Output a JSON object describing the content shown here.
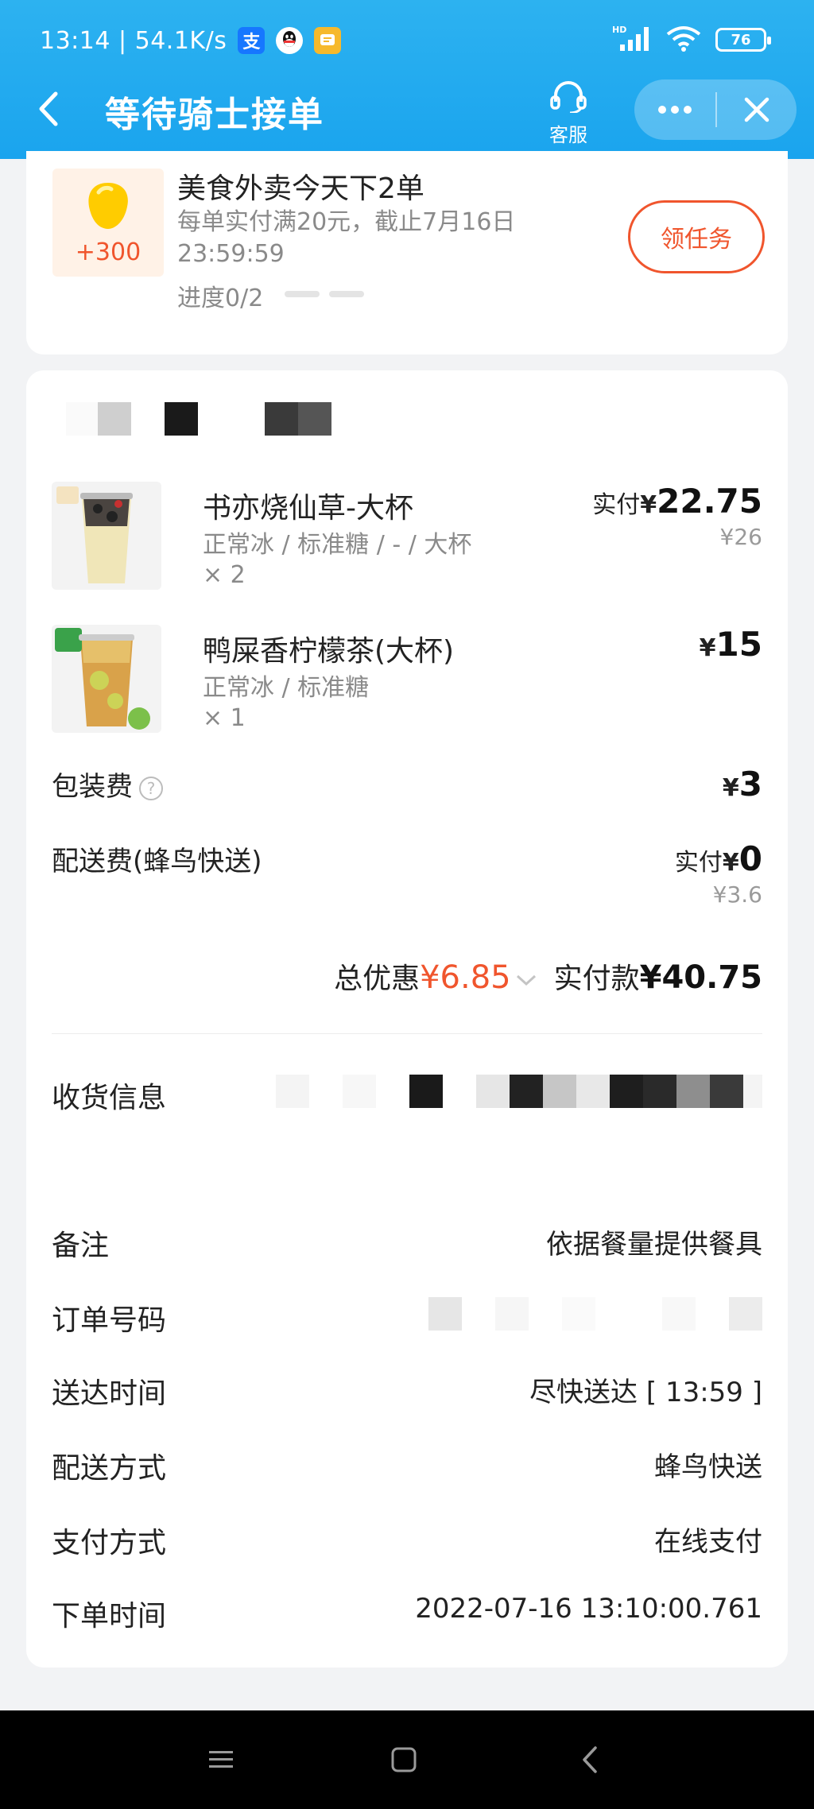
{
  "status_bar": {
    "time_speed": "13:14 | 54.1K/s",
    "alipay_glyph": "支",
    "network_badge": "HD",
    "battery": "76"
  },
  "header": {
    "title": "等待骑士接单",
    "customer_service": "客服",
    "colors": {
      "bar": "#1aa4ee"
    }
  },
  "task": {
    "reward": "+300",
    "title": "美食外卖今天下2单",
    "description": "每单实付满20元，截止7月16日23:59:59",
    "progress": "进度0/2",
    "progress_done": 0,
    "progress_total": 2,
    "claim_button": "领任务"
  },
  "items": [
    {
      "name": "书亦烧仙草-大杯",
      "spec": "正常冰 / 标准糖 / - / 大杯",
      "qty": "× 2",
      "paid_label": "实付",
      "currency": "¥",
      "price": "22.75",
      "original_price": "¥26"
    },
    {
      "name": "鸭屎香柠檬茶(大杯)",
      "spec": "正常冰 / 标准糖",
      "qty": "× 1",
      "currency": "¥",
      "price": "15"
    }
  ],
  "fees": {
    "packaging_label": "包装费",
    "packaging_currency": "¥",
    "packaging_value": "3",
    "delivery_label": "配送费(蜂鸟快送)",
    "delivery_paid_label": "实付",
    "delivery_currency": "¥",
    "delivery_value": "0",
    "delivery_original": "¥3.6"
  },
  "summary": {
    "discount_label": "总优惠",
    "discount_value": "¥6.85",
    "total_label": "实付款",
    "total_value": "¥40.75"
  },
  "info": {
    "receiver_label": "收货信息",
    "remark_label": "备注",
    "remark_value": "依据餐量提供餐具",
    "order_no_label": "订单号码",
    "arrival_label": "送达时间",
    "arrival_value": "尽快送达 [ 13:59 ]",
    "delivery_method_label": "配送方式",
    "delivery_method_value": "蜂鸟快送",
    "payment_label": "支付方式",
    "payment_value": "在线支付",
    "order_time_label": "下单时间",
    "order_time_value": "2022-07-16 13:10:00.761"
  },
  "colors": {
    "accent_red": "#f0552d",
    "muted_text": "#8a8a8a",
    "page_bg": "#f2f3f5"
  }
}
